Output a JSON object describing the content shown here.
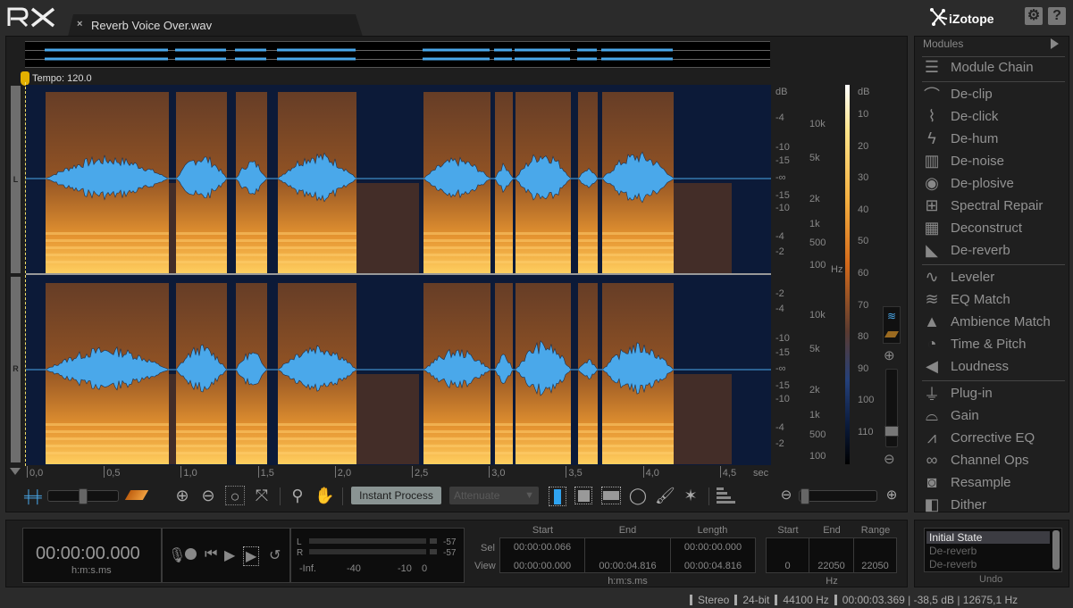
{
  "app": {
    "logo": "RX",
    "brand": "iZotope"
  },
  "tab": {
    "title": "Reverb Voice Over.wav",
    "close": "×"
  },
  "header": {
    "settings_icon": "gear-icon",
    "help_label": "?"
  },
  "editor": {
    "tempo": "Tempo: 120.0",
    "channels": [
      "L",
      "R"
    ],
    "time_axis": {
      "labels": [
        "0,0",
        "0,5",
        "1,0",
        "1,5",
        "2,0",
        "2,5",
        "3,0",
        "3,5",
        "4,0",
        "4,5"
      ],
      "unit": "sec"
    },
    "amp_axis_L": [
      "dB",
      "-4",
      "-10",
      "-15",
      "-∞",
      "-15",
      "-10",
      "-4",
      "-2"
    ],
    "amp_axis_R": [
      "-2",
      "-4",
      "-10",
      "-15",
      "-∞",
      "-15",
      "-10",
      "-4",
      "-2"
    ],
    "freq_axis_L": [
      "10k",
      "5k",
      "2k",
      "1k",
      "500",
      "100"
    ],
    "freq_axis_R": [
      "10k",
      "5k",
      "2k",
      "1k",
      "500",
      "100"
    ],
    "freq_unit": "Hz",
    "colorbar": {
      "title": "dB",
      "labels": [
        "10",
        "20",
        "30",
        "40",
        "50",
        "60",
        "70",
        "80",
        "90",
        "100",
        "110"
      ]
    },
    "colors": {
      "waveform": "#4aa8ea",
      "spectro_bg": "#0c1a38",
      "spectro_hot": "#f5a030"
    }
  },
  "toolbar": {
    "instant_process": "Instant Process",
    "attenuate": "Attenuate",
    "attenuate_arrow": "▼"
  },
  "modules": {
    "header": "Modules",
    "items": [
      {
        "label": "Module Chain",
        "icon": "module-chain-icon"
      },
      {
        "label": "De-clip",
        "icon": "de-clip-icon"
      },
      {
        "label": "De-click",
        "icon": "de-click-icon"
      },
      {
        "label": "De-hum",
        "icon": "de-hum-icon"
      },
      {
        "label": "De-noise",
        "icon": "de-noise-icon"
      },
      {
        "label": "De-plosive",
        "icon": "de-plosive-icon"
      },
      {
        "label": "Spectral Repair",
        "icon": "spectral-repair-icon"
      },
      {
        "label": "Deconstruct",
        "icon": "deconstruct-icon"
      },
      {
        "label": "De-reverb",
        "icon": "de-reverb-icon"
      },
      {
        "label": "Leveler",
        "icon": "leveler-icon"
      },
      {
        "label": "EQ Match",
        "icon": "eq-match-icon"
      },
      {
        "label": "Ambience Match",
        "icon": "ambience-match-icon"
      },
      {
        "label": "Time & Pitch",
        "icon": "time-pitch-icon"
      },
      {
        "label": "Loudness",
        "icon": "loudness-icon"
      },
      {
        "label": "Plug-in",
        "icon": "plug-in-icon"
      },
      {
        "label": "Gain",
        "icon": "gain-icon"
      },
      {
        "label": "Corrective EQ",
        "icon": "corrective-eq-icon"
      },
      {
        "label": "Channel Ops",
        "icon": "channel-ops-icon"
      },
      {
        "label": "Resample",
        "icon": "resample-icon"
      },
      {
        "label": "Dither",
        "icon": "dither-icon"
      }
    ]
  },
  "transport": {
    "time": "00:00:00.000",
    "time_unit": "h:m:s.ms",
    "meter": {
      "L_label": "L",
      "R_label": "R",
      "L_peak": "-57",
      "R_peak": "-57",
      "scale": [
        "-Inf.",
        "-40",
        "-10",
        "0"
      ]
    }
  },
  "selection": {
    "headers": [
      "Start",
      "End",
      "Length"
    ],
    "rows": [
      {
        "label": "Sel",
        "start": "00:00:00.066",
        "end": "",
        "length": "00:00:00.000"
      },
      {
        "label": "View",
        "start": "00:00:00.000",
        "end": "00:00:04.816",
        "length": "00:00:04.816"
      }
    ],
    "unit": "h:m:s.ms",
    "freq_headers": [
      "Start",
      "End",
      "Range"
    ],
    "freq_values": [
      "0",
      "22050",
      "22050"
    ],
    "freq_unit": "Hz"
  },
  "undo": {
    "items": [
      "Initial State",
      "De-reverb",
      "De-reverb"
    ],
    "label": "Undo"
  },
  "status": {
    "channels": "Stereo",
    "bit_depth": "24-bit",
    "sample_rate": "44100 Hz",
    "cursor": "00:00:03.369 | -38,5 dB | 12675,1 Hz"
  }
}
